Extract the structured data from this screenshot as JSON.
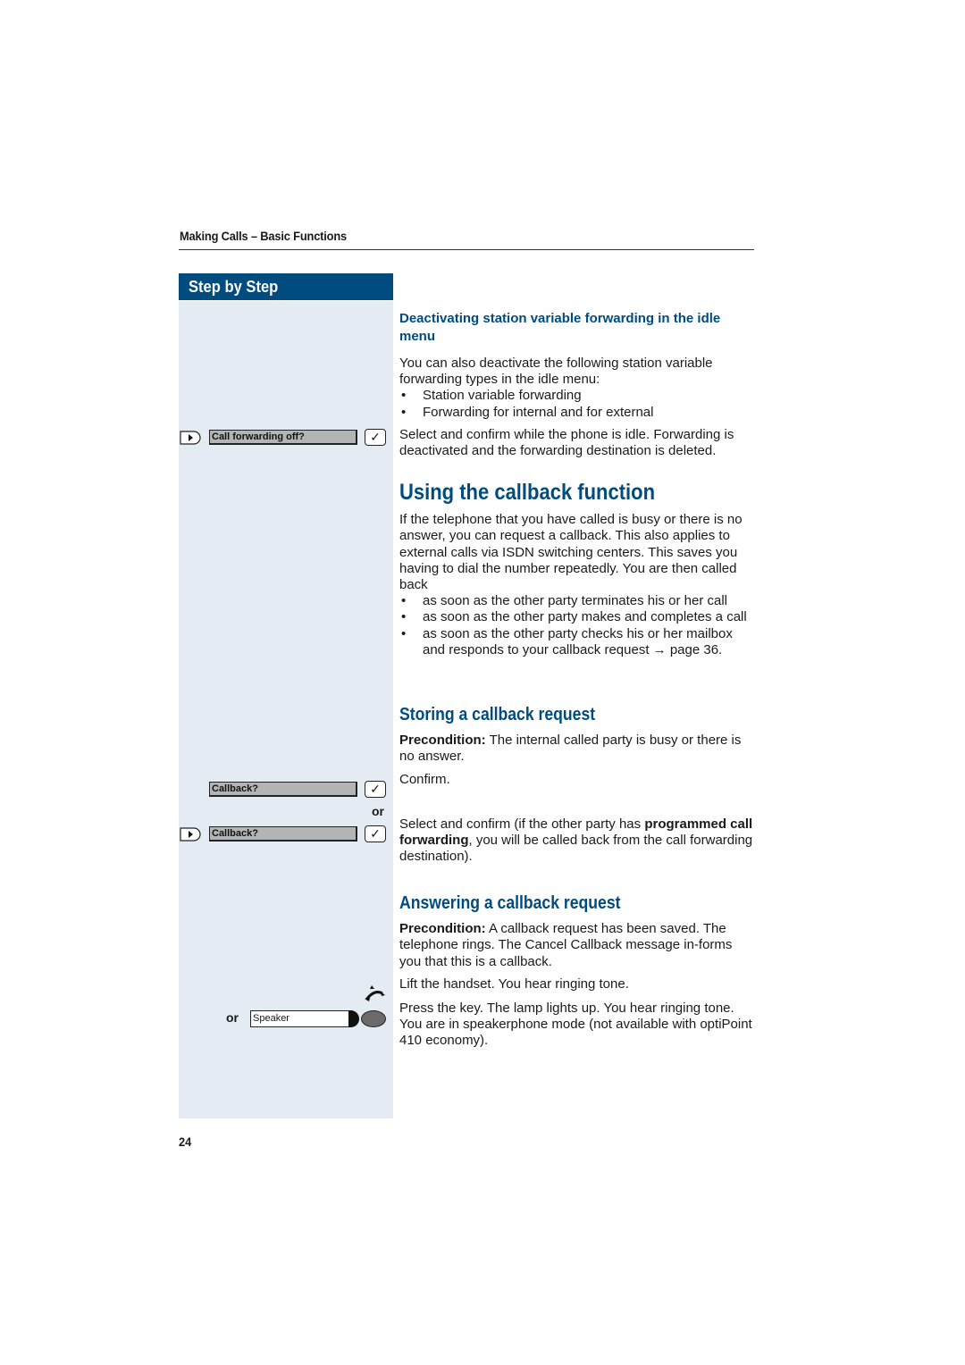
{
  "running_head": "Making Calls – Basic Functions",
  "sidebar": {
    "title": "Step by Step",
    "keys": {
      "call_forwarding_off": "Call forwarding off?",
      "callback_1": "Callback?",
      "callback_or": "or",
      "callback_2": "Callback?",
      "speaker_or": "or",
      "speaker": "Speaker"
    },
    "colors": {
      "header_bg": "#004c7f",
      "column_bg": "#e4ebf2",
      "display_bg": "#b4b4b4"
    }
  },
  "section_deactivate": {
    "heading": "Deactivating station variable forwarding in the idle menu",
    "intro": "You can also deactivate the following station variable forwarding types in the idle menu:",
    "bullets": [
      "Station variable forwarding",
      "Forwarding for internal and for external"
    ],
    "instruction": "Select and confirm while the phone is idle. Forwarding is deactivated and the forwarding destination is deleted."
  },
  "section_callback": {
    "title": "Using the callback function",
    "intro": "If the telephone that you have called is busy or there is no answer, you can request a callback. This also applies to external calls via ISDN switching centers. This saves you having to dial the number repeatedly. You are then called back",
    "bullets": [
      "as soon as the other party terminates his or her call",
      "as soon as the other party makes and completes a call",
      "as soon as the other party checks his or her mailbox and responds to your callback request → page 36."
    ]
  },
  "section_storing": {
    "title": "Storing a callback request",
    "precondition_label": "Precondition:",
    "precondition_text": " The internal called party is busy or there is no answer.",
    "confirm": "Confirm.",
    "select_prefix": "Select and confirm (if the other party has ",
    "select_bold": "programmed call forwarding",
    "select_suffix": ", you will be called back from the call forwarding destination)."
  },
  "section_answering": {
    "title": "Answering a callback request",
    "precondition_label": "Precondition:",
    "precondition_text": " A callback request has been saved. The telephone rings. The Cancel Callback message in-forms you that this is a callback.",
    "lift": "Lift the handset. You hear ringing tone.",
    "press": "Press the key. The lamp lights up. You hear ringing tone. You are in speakerphone mode (not available with optiPoint 410 economy)."
  },
  "page_number": "24"
}
